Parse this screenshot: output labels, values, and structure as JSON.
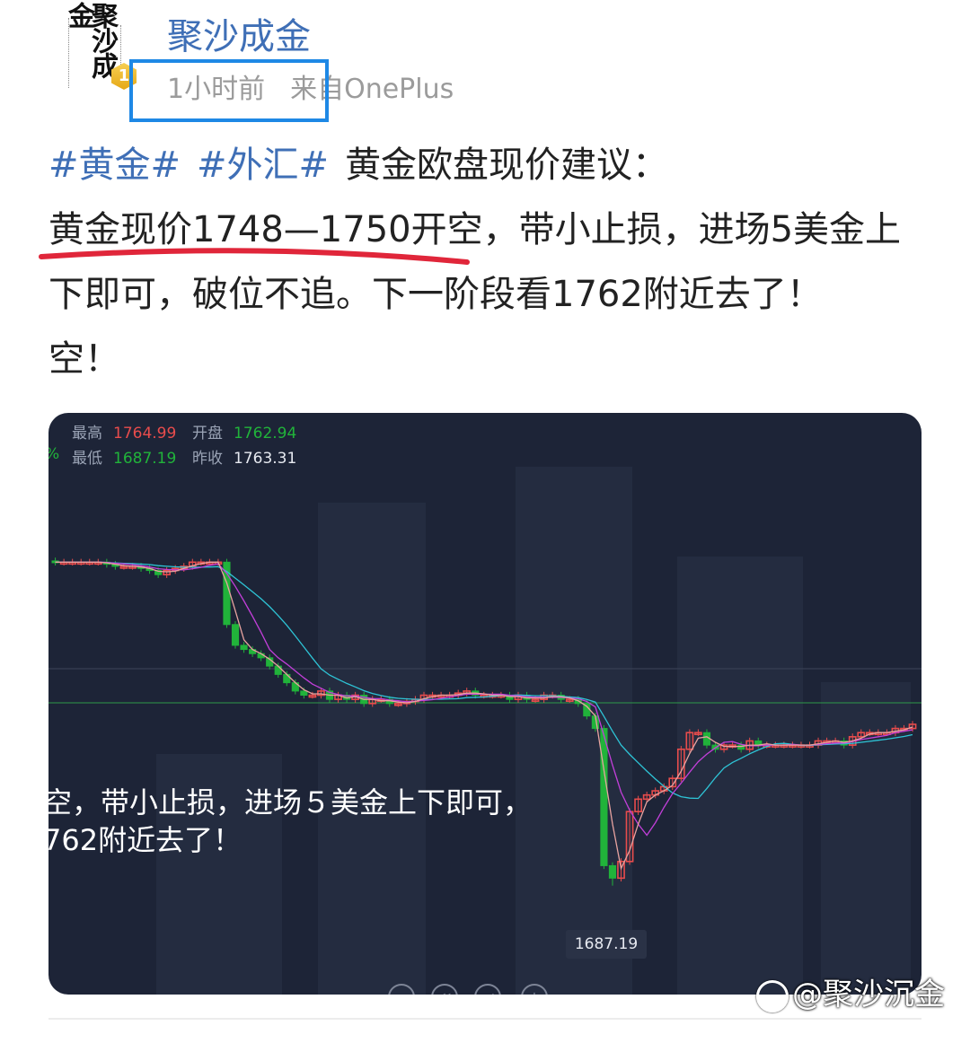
{
  "post": {
    "username": "聚沙成金",
    "badge_level": "1",
    "time": "1小时前",
    "source": "来自OnePlus",
    "tags": [
      "#黄金#",
      "#外汇#"
    ],
    "line1": "黄金欧盘现价建议：",
    "line2_underlined": "黄金现价1748—1750开空",
    "line2_rest": "，带小止损，进场5美金上",
    "line3": "下即可，破位不追。下一阶段看1762附近去了！",
    "line4": "空！",
    "avatar_text": "聚沙成金",
    "highlight_color": "#1e88e5",
    "underline_color": "#e0263a"
  },
  "chart": {
    "stats": {
      "high_label": "最高",
      "high_value": "1764.99",
      "open_label": "开盘",
      "open_value": "1762.94",
      "low_label": "最低",
      "low_value": "1687.19",
      "prev_close_label": "昨收",
      "prev_close_value": "1763.31",
      "pct_fragment": "%"
    },
    "overlay_line1": "空，带小止损，进场５美金上下即可，",
    "overlay_line2": "762附近去了！",
    "low_marker": "1687.19",
    "colors": {
      "up": "#e84c4c",
      "down": "#21b33a",
      "bg": "#1d2437",
      "ma1": "#2ec4d6",
      "ma2": "#c23fd9",
      "ma3": "#e8a3a0"
    }
  },
  "chart_data": {
    "type": "candlestick",
    "title": "",
    "ylim": [
      1680,
      1775
    ],
    "closes": [
      1765,
      1765,
      1765,
      1765,
      1765,
      1765,
      1764.5,
      1764,
      1764,
      1764,
      1763.5,
      1763,
      1762,
      1763,
      1763.5,
      1764,
      1765,
      1765,
      1765,
      1765,
      1750,
      1745,
      1744,
      1743,
      1742,
      1740,
      1738,
      1736,
      1734,
      1733,
      1733,
      1734,
      1732,
      1733,
      1732,
      1733,
      1731,
      1732,
      1732,
      1731,
      1731,
      1731.5,
      1732,
      1733,
      1733,
      1733,
      1733,
      1733.5,
      1734,
      1733,
      1733,
      1733,
      1733,
      1732,
      1733,
      1732,
      1732,
      1733,
      1733,
      1732,
      1732,
      1731,
      1728,
      1725,
      1692,
      1689,
      1693,
      1705,
      1708,
      1709,
      1710,
      1711,
      1713,
      1720,
      1724,
      1724,
      1721,
      1720,
      1721,
      1721,
      1720,
      1722,
      1721,
      1721,
      1721,
      1721,
      1721,
      1721,
      1721,
      1722,
      1722,
      1722,
      1721,
      1723,
      1724,
      1724,
      1724,
      1724,
      1725,
      1725,
      1726
    ],
    "low_annotation": 1687.19,
    "series": [
      {
        "name": "MA1"
      },
      {
        "name": "MA2"
      },
      {
        "name": "MA3"
      }
    ]
  },
  "watermark": {
    "text": "@聚沙沉金"
  },
  "controls": [
    "−",
    "⏮",
    "⏭",
    "+"
  ]
}
